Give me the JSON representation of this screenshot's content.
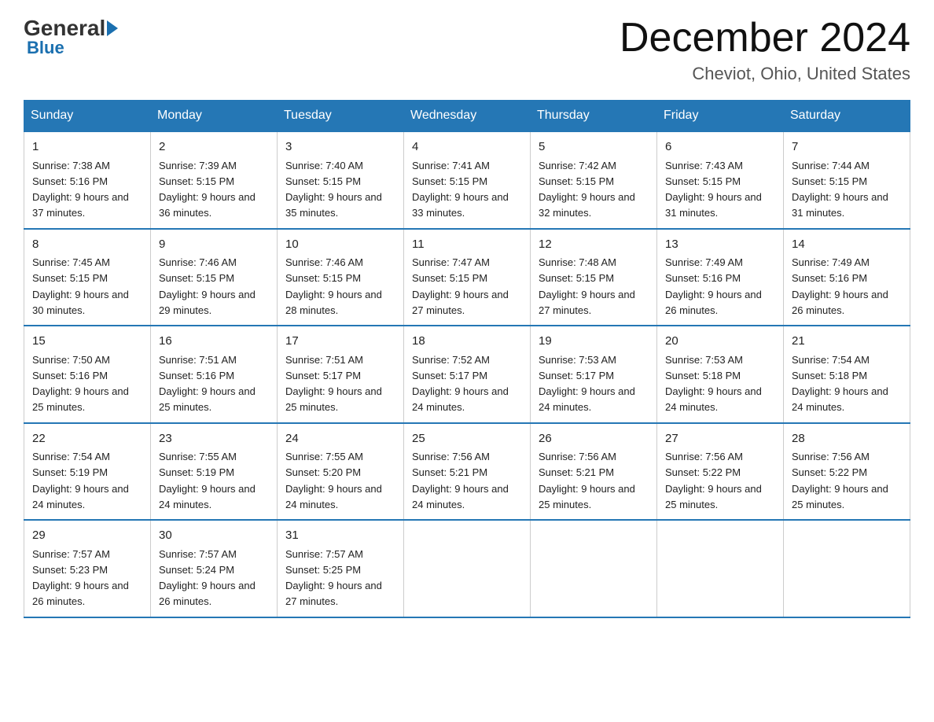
{
  "logo": {
    "text_general": "General",
    "text_blue": "Blue"
  },
  "title": "December 2024",
  "location": "Cheviot, Ohio, United States",
  "days_of_week": [
    "Sunday",
    "Monday",
    "Tuesday",
    "Wednesday",
    "Thursday",
    "Friday",
    "Saturday"
  ],
  "weeks": [
    [
      {
        "day": "1",
        "sunrise": "7:38 AM",
        "sunset": "5:16 PM",
        "daylight": "9 hours and 37 minutes."
      },
      {
        "day": "2",
        "sunrise": "7:39 AM",
        "sunset": "5:15 PM",
        "daylight": "9 hours and 36 minutes."
      },
      {
        "day": "3",
        "sunrise": "7:40 AM",
        "sunset": "5:15 PM",
        "daylight": "9 hours and 35 minutes."
      },
      {
        "day": "4",
        "sunrise": "7:41 AM",
        "sunset": "5:15 PM",
        "daylight": "9 hours and 33 minutes."
      },
      {
        "day": "5",
        "sunrise": "7:42 AM",
        "sunset": "5:15 PM",
        "daylight": "9 hours and 32 minutes."
      },
      {
        "day": "6",
        "sunrise": "7:43 AM",
        "sunset": "5:15 PM",
        "daylight": "9 hours and 31 minutes."
      },
      {
        "day": "7",
        "sunrise": "7:44 AM",
        "sunset": "5:15 PM",
        "daylight": "9 hours and 31 minutes."
      }
    ],
    [
      {
        "day": "8",
        "sunrise": "7:45 AM",
        "sunset": "5:15 PM",
        "daylight": "9 hours and 30 minutes."
      },
      {
        "day": "9",
        "sunrise": "7:46 AM",
        "sunset": "5:15 PM",
        "daylight": "9 hours and 29 minutes."
      },
      {
        "day": "10",
        "sunrise": "7:46 AM",
        "sunset": "5:15 PM",
        "daylight": "9 hours and 28 minutes."
      },
      {
        "day": "11",
        "sunrise": "7:47 AM",
        "sunset": "5:15 PM",
        "daylight": "9 hours and 27 minutes."
      },
      {
        "day": "12",
        "sunrise": "7:48 AM",
        "sunset": "5:15 PM",
        "daylight": "9 hours and 27 minutes."
      },
      {
        "day": "13",
        "sunrise": "7:49 AM",
        "sunset": "5:16 PM",
        "daylight": "9 hours and 26 minutes."
      },
      {
        "day": "14",
        "sunrise": "7:49 AM",
        "sunset": "5:16 PM",
        "daylight": "9 hours and 26 minutes."
      }
    ],
    [
      {
        "day": "15",
        "sunrise": "7:50 AM",
        "sunset": "5:16 PM",
        "daylight": "9 hours and 25 minutes."
      },
      {
        "day": "16",
        "sunrise": "7:51 AM",
        "sunset": "5:16 PM",
        "daylight": "9 hours and 25 minutes."
      },
      {
        "day": "17",
        "sunrise": "7:51 AM",
        "sunset": "5:17 PM",
        "daylight": "9 hours and 25 minutes."
      },
      {
        "day": "18",
        "sunrise": "7:52 AM",
        "sunset": "5:17 PM",
        "daylight": "9 hours and 24 minutes."
      },
      {
        "day": "19",
        "sunrise": "7:53 AM",
        "sunset": "5:17 PM",
        "daylight": "9 hours and 24 minutes."
      },
      {
        "day": "20",
        "sunrise": "7:53 AM",
        "sunset": "5:18 PM",
        "daylight": "9 hours and 24 minutes."
      },
      {
        "day": "21",
        "sunrise": "7:54 AM",
        "sunset": "5:18 PM",
        "daylight": "9 hours and 24 minutes."
      }
    ],
    [
      {
        "day": "22",
        "sunrise": "7:54 AM",
        "sunset": "5:19 PM",
        "daylight": "9 hours and 24 minutes."
      },
      {
        "day": "23",
        "sunrise": "7:55 AM",
        "sunset": "5:19 PM",
        "daylight": "9 hours and 24 minutes."
      },
      {
        "day": "24",
        "sunrise": "7:55 AM",
        "sunset": "5:20 PM",
        "daylight": "9 hours and 24 minutes."
      },
      {
        "day": "25",
        "sunrise": "7:56 AM",
        "sunset": "5:21 PM",
        "daylight": "9 hours and 24 minutes."
      },
      {
        "day": "26",
        "sunrise": "7:56 AM",
        "sunset": "5:21 PM",
        "daylight": "9 hours and 25 minutes."
      },
      {
        "day": "27",
        "sunrise": "7:56 AM",
        "sunset": "5:22 PM",
        "daylight": "9 hours and 25 minutes."
      },
      {
        "day": "28",
        "sunrise": "7:56 AM",
        "sunset": "5:22 PM",
        "daylight": "9 hours and 25 minutes."
      }
    ],
    [
      {
        "day": "29",
        "sunrise": "7:57 AM",
        "sunset": "5:23 PM",
        "daylight": "9 hours and 26 minutes."
      },
      {
        "day": "30",
        "sunrise": "7:57 AM",
        "sunset": "5:24 PM",
        "daylight": "9 hours and 26 minutes."
      },
      {
        "day": "31",
        "sunrise": "7:57 AM",
        "sunset": "5:25 PM",
        "daylight": "9 hours and 27 minutes."
      },
      null,
      null,
      null,
      null
    ]
  ],
  "labels": {
    "sunrise": "Sunrise:",
    "sunset": "Sunset:",
    "daylight": "Daylight:"
  }
}
